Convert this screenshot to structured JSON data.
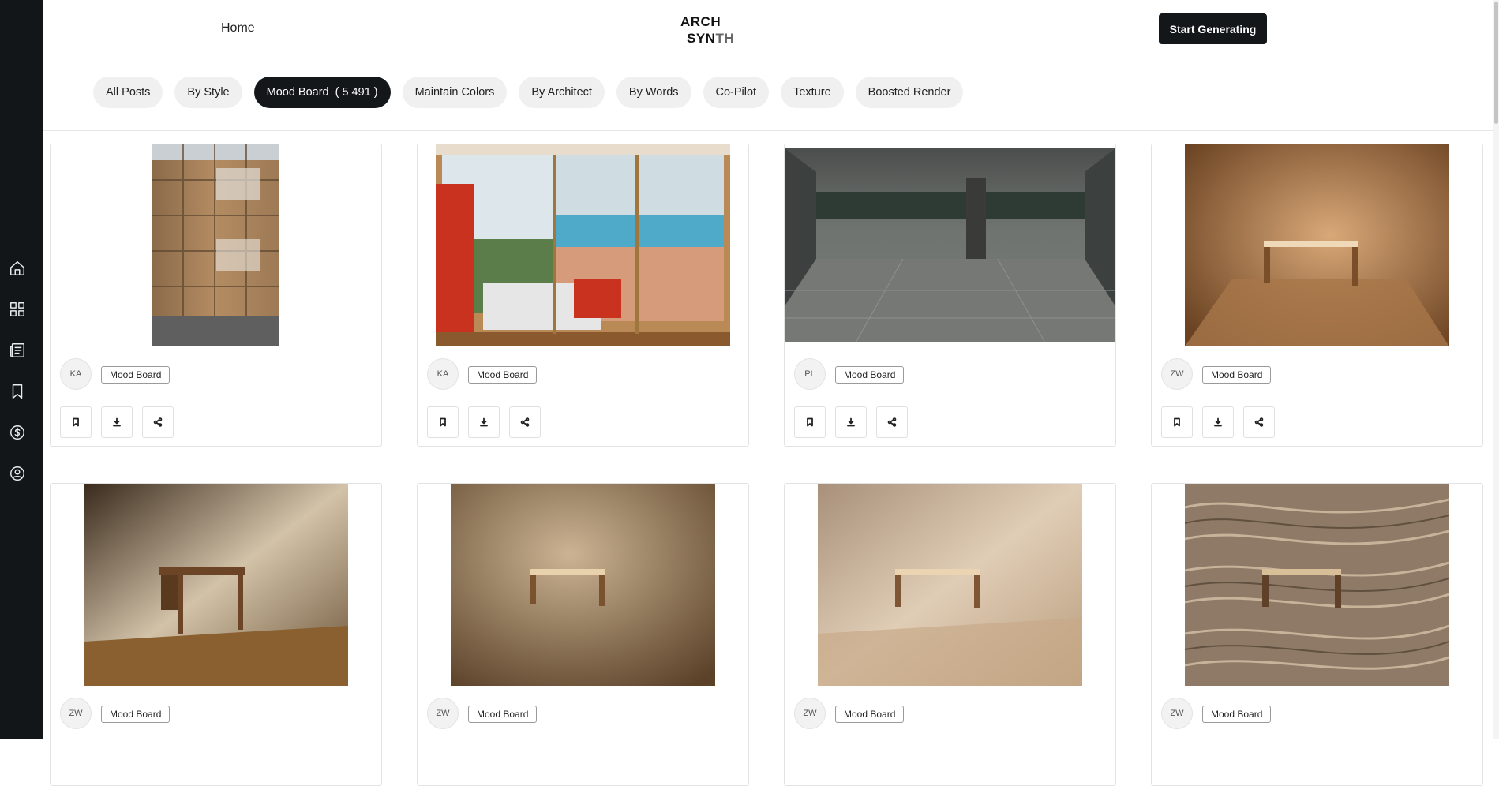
{
  "header": {
    "home_label": "Home",
    "logo_line1": "ARCH",
    "logo_line2a": "SYN",
    "logo_line2b": "TH",
    "cta_label": "Start Generating"
  },
  "sidebar": {
    "icons": [
      "home-icon",
      "dashboard-icon",
      "news-icon",
      "bookmark-icon",
      "dollar-icon",
      "account-icon"
    ]
  },
  "filters": [
    {
      "label": "All Posts"
    },
    {
      "label": "By Style"
    },
    {
      "label": "Mood Board",
      "count": "( 5 491 )",
      "active": true
    },
    {
      "label": "Maintain Colors"
    },
    {
      "label": "By Architect"
    },
    {
      "label": "By Words"
    },
    {
      "label": "Co-Pilot"
    },
    {
      "label": "Texture"
    },
    {
      "label": "Boosted Render"
    }
  ],
  "cards": [
    {
      "avatar": "KA",
      "tag": "Mood Board",
      "image": "timber-apartment-facade"
    },
    {
      "avatar": "KA",
      "tag": "Mood Board",
      "image": "hospital-room-sea-view"
    },
    {
      "avatar": "PL",
      "tag": "Mood Board",
      "image": "empty-grey-tiled-hall"
    },
    {
      "avatar": "ZW",
      "tag": "Mood Board",
      "image": "wooden-table-warm-room"
    },
    {
      "avatar": "ZW",
      "tag": "Mood Board",
      "image": "drop-leaf-table-sunlit-room"
    },
    {
      "avatar": "ZW",
      "tag": "Mood Board",
      "image": "wooden-bench-brown-room"
    },
    {
      "avatar": "ZW",
      "tag": "Mood Board",
      "image": "wooden-bench-beige-room"
    },
    {
      "avatar": "ZW",
      "tag": "Mood Board",
      "image": "wooden-bench-woodgrain-room"
    }
  ],
  "colors": {
    "sidebar": "#131619",
    "accent_dark": "#14171a",
    "pill_bg": "#f0f0f0"
  }
}
